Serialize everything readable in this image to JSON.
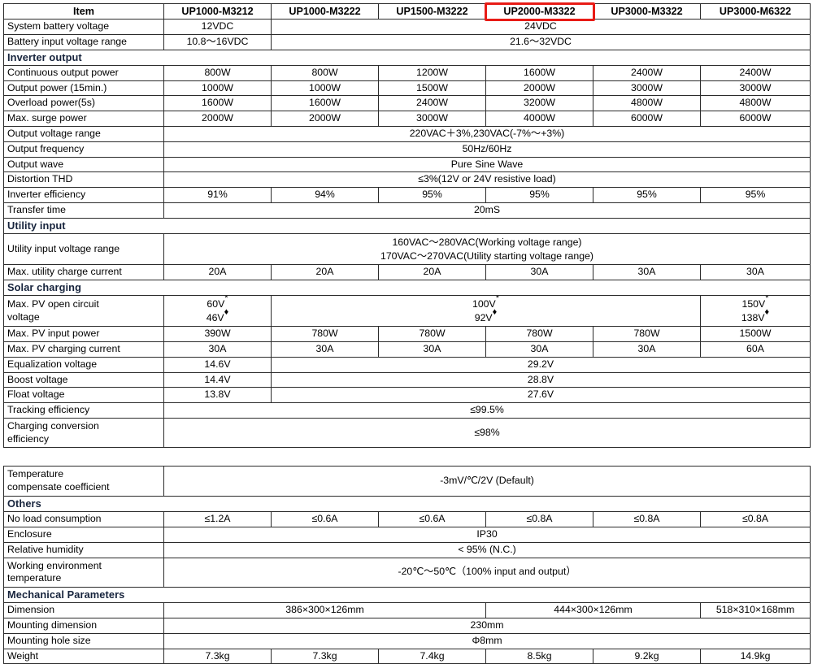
{
  "table": {
    "columns": [
      "Item",
      "UP1000-M3212",
      "UP1000-M3222",
      "UP1500-M3222",
      "UP2000-M3322",
      "UP3000-M3322",
      "UP3000-M6322"
    ],
    "highlighted_column": "UP2000-M3322",
    "highlight_color": "#e81b16",
    "section_header_bg": "#c9d9ec",
    "sections": {
      "inverter_output": "Inverter output",
      "utility_input": "Utility input",
      "solar_charging": "Solar charging",
      "others": "Others",
      "mechanical_parameters": "Mechanical Parameters"
    },
    "rows": {
      "system_battery_voltage": {
        "label": "System battery voltage",
        "v1": "12VDC",
        "v2_6": "24VDC"
      },
      "battery_input_voltage_range": {
        "label": "Battery input voltage range",
        "v1": "10.8〜16VDC",
        "v2_6": "21.6〜32VDC"
      },
      "continuous_output_power": {
        "label": "Continuous output power",
        "values": [
          "800W",
          "800W",
          "1200W",
          "1600W",
          "2400W",
          "2400W"
        ]
      },
      "output_power_15min": {
        "label": "Output power (15min.)",
        "values": [
          "1000W",
          "1000W",
          "1500W",
          "2000W",
          "3000W",
          "3000W"
        ]
      },
      "overload_power_5s": {
        "label": "Overload power(5s)",
        "values": [
          "1600W",
          "1600W",
          "2400W",
          "3200W",
          "4800W",
          "4800W"
        ]
      },
      "max_surge_power": {
        "label": "Max. surge power",
        "values": [
          "2000W",
          "2000W",
          "3000W",
          "4000W",
          "6000W",
          "6000W"
        ]
      },
      "output_voltage_range": {
        "label": "Output voltage range",
        "value": "220VAC＋3%,230VAC(-7%〜+3%)"
      },
      "output_frequency": {
        "label": "Output frequency",
        "value": "50Hz/60Hz"
      },
      "output_wave": {
        "label": "Output wave",
        "value": "Pure Sine Wave"
      },
      "distortion_thd": {
        "label": "Distortion THD",
        "value": "≤3%(12V or 24V resistive load)"
      },
      "inverter_efficiency": {
        "label": "Inverter efficiency",
        "values": [
          "91%",
          "94%",
          "95%",
          "95%",
          "95%",
          "95%"
        ]
      },
      "transfer_time": {
        "label": "Transfer time",
        "value": "20mS"
      },
      "utility_input_voltage_range": {
        "label": "Utility input voltage range",
        "line1": "160VAC〜280VAC(Working voltage range)",
        "line2": "170VAC〜270VAC(Utility starting voltage range)"
      },
      "max_utility_charge_current": {
        "label": "Max. utility charge current",
        "values": [
          "20A",
          "20A",
          "20A",
          "30A",
          "30A",
          "30A"
        ]
      },
      "max_pv_open_circuit_voltage": {
        "label_line1": "Max. PV open circuit",
        "label_line2": "voltage",
        "c1_top": "60V",
        "c1_bottom": "46V",
        "c2_5_top": "100V",
        "c2_5_bottom": "92V",
        "c6_top": "150V",
        "c6_bottom": "138V",
        "marker_top": "*",
        "marker_bottom": "♦"
      },
      "max_pv_input_power": {
        "label": "Max. PV input power",
        "values": [
          "390W",
          "780W",
          "780W",
          "780W",
          "780W",
          "1500W"
        ]
      },
      "max_pv_charging_current": {
        "label": "Max. PV charging current",
        "values": [
          "30A",
          "30A",
          "30A",
          "30A",
          "30A",
          "60A"
        ]
      },
      "equalization_voltage": {
        "label": "Equalization voltage",
        "v1": "14.6V",
        "v2_6": "29.2V"
      },
      "boost_voltage": {
        "label": "Boost voltage",
        "v1": "14.4V",
        "v2_6": "28.8V"
      },
      "float_voltage": {
        "label": "Float voltage",
        "v1": "13.8V",
        "v2_6": "27.6V"
      },
      "tracking_efficiency": {
        "label": "Tracking efficiency",
        "value": "≤99.5%"
      },
      "charging_conversion_efficiency": {
        "label_line1": "Charging conversion",
        "label_line2": "efficiency",
        "value": "≤98%"
      },
      "temperature_compensate_coefficient": {
        "label_line1": "Temperature",
        "label_line2": "compensate coefficient",
        "value": "-3mV/℃/2V (Default)"
      },
      "no_load_consumption": {
        "label": "No load consumption",
        "values": [
          "≤1.2A",
          "≤0.6A",
          "≤0.6A",
          "≤0.8A",
          "≤0.8A",
          "≤0.8A"
        ]
      },
      "enclosure": {
        "label": "Enclosure",
        "value": "IP30"
      },
      "relative_humidity": {
        "label": "Relative humidity",
        "value": "< 95% (N.C.)"
      },
      "working_environment_temperature": {
        "label_line1": "Working environment",
        "label_line2": "temperature",
        "value": "-20℃〜50℃（100% input and output）"
      },
      "dimension": {
        "label": "Dimension",
        "v1_3": "386×300×126mm",
        "v4_5": "444×300×126mm",
        "v6": "518×310×168mm"
      },
      "mounting_dimension": {
        "label": "Mounting dimension",
        "value": "230mm"
      },
      "mounting_hole_size": {
        "label": "Mounting hole size",
        "value": "Φ8mm"
      },
      "weight": {
        "label": "Weight",
        "values": [
          "7.3kg",
          "7.3kg",
          "7.4kg",
          "8.5kg",
          "9.2kg",
          "14.9kg"
        ]
      }
    }
  }
}
